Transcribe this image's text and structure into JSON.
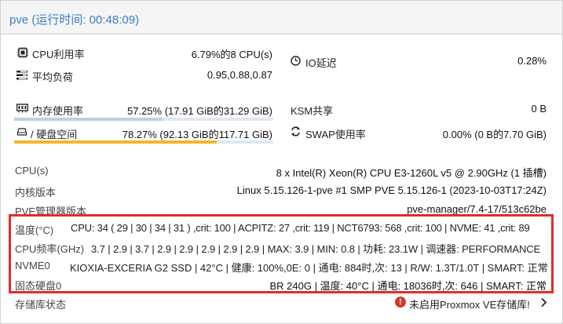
{
  "header": {
    "title": "pve (运行时间: 00:48:09)"
  },
  "stats": {
    "cpu": {
      "label": "CPU利用率",
      "value": "6.79%的8 CPU(s)"
    },
    "iowait": {
      "label": "IO延迟",
      "value": "0.28%"
    },
    "load": {
      "label": "平均负荷",
      "value": "0.95,0.88,0.87"
    },
    "memory": {
      "label": "内存使用率",
      "value": "57.25% (17.91 GiB的31.29 GiB)",
      "fraction": 0.5725
    },
    "ksm": {
      "label": "KSM共享",
      "value": "0 B"
    },
    "disk": {
      "label": "/ 硬盘空间",
      "value": "78.27% (92.13 GiB的117.71 GiB)",
      "fraction": 0.7827
    },
    "swap": {
      "label": "SWAP使用率",
      "value": "0.00% (0 B的7.70 GiB)"
    }
  },
  "info": {
    "cpus": {
      "label": "CPU(s)",
      "value": "8 x Intel(R) Xeon(R) CPU E3-1260L v5 @ 2.90GHz (1 插槽)"
    },
    "kernel": {
      "label": "内核版本",
      "value": "Linux 5.15.126-1-pve #1 SMP PVE 5.15.126-1 (2023-10-03T17:24Z)"
    },
    "pve": {
      "label": "PVE管理器版本",
      "value": "pve-manager/7.4-17/513c62be"
    }
  },
  "sensors": {
    "temp": {
      "label": "温度(°C)",
      "value": "CPU: 34 ( 29 | 30 | 34 | 31 ) ,crit: 100 | ACPITZ: 27 ,crit: 119 | NCT6793: 568 ,crit: 100 | NVME: 41 ,crit: 89"
    },
    "freq": {
      "label": "CPU频率(GHz)",
      "value": "3.7 | 2.9 | 3.7 | 2.9 | 2.9 | 2.9 | 2.9 | 2.9 | MAX: 3.9 | MIN: 0.8 | 功耗: 23.1W | 调速器: PERFORMANCE"
    },
    "nvme": {
      "label": "NVME0",
      "value": "KIOXIA-EXCERIA G2 SSD | 42°C | 健康: 100%,0E: 0 | 通电: 884时,次: 13 | R/W: 1.3T/1.0T | SMART: 正常"
    },
    "ssd": {
      "label": "固态硬盘0",
      "value": "BR 240G | 温度: 40°C | 通电: 18036时,次: 646 | SMART: 正常"
    }
  },
  "repo": {
    "label": "存储库状态",
    "status": "未启用Proxmox VE存储库!",
    "icon": "exclamation-icon",
    "color": "#d9342b"
  }
}
